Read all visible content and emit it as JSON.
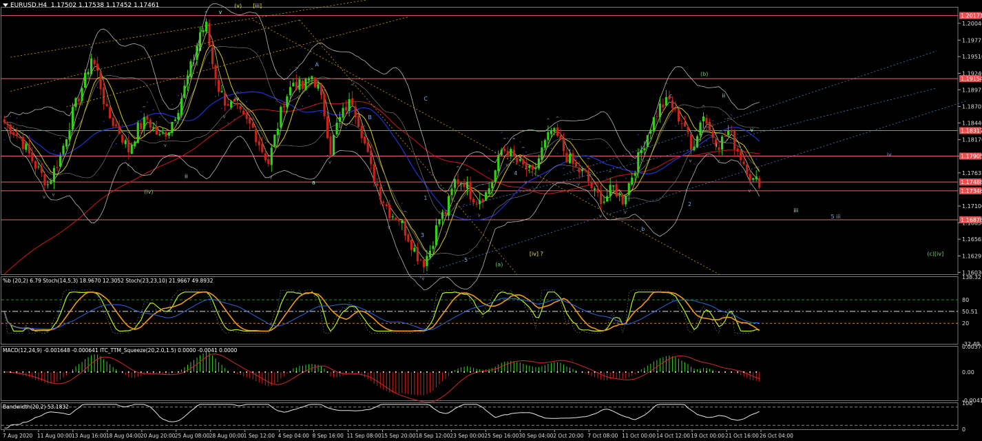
{
  "header": {
    "symbol": "EURUSD,H4",
    "ohlc": "1.17502 1.17538 1.17452 1.17461"
  },
  "colors": {
    "background": "#000000",
    "grid_line": "#2b2b2b",
    "hline": "#e06a6a",
    "candle_up": "#33d11a",
    "candle_down": "#d0201a",
    "ma_red": "#d01818",
    "ma_blue": "#2233cc",
    "ma_yellow": "#d8c81a",
    "bands": "#b8b8b8",
    "fib_orange": "#d8a010",
    "channel_blue": "#4f7fc7",
    "label_bg": "#e65050"
  },
  "chart_data": [
    {
      "type": "candlestick",
      "title": "EURUSD,H4",
      "ylim": [
        1.16,
        1.203
      ],
      "price_ticks": [
        "1.20046",
        "1.19775",
        "1.19510",
        "1.19240",
        "1.18975",
        "1.18705",
        "1.18440",
        "1.18170",
        "1.17905",
        "1.17635",
        "1.17100",
        "1.16830",
        "1.16565",
        "1.16295",
        "1.16030"
      ],
      "highlighted_levels": [
        "1.20171",
        "1.19154",
        "1.18317",
        "1.17905",
        "1.17488",
        "1.17346",
        "1.16878"
      ],
      "time_labels": [
        "7 Aug 2020",
        "11 Aug 00:00",
        "13 Aug 16:00",
        "18 Aug 04:00",
        "20 Aug 20:00",
        "25 Aug 08:00",
        "28 Aug 00:00",
        "1 Sep 12:00",
        "4 Sep 04:00",
        "8 Sep 16:00",
        "11 Sep 08:00",
        "15 Sep 20:00",
        "18 Sep 12:00",
        "23 Sep 00:00",
        "25 Sep 16:00",
        "30 Sep 04:00",
        "2 Oct 20:00",
        "7 Oct 08:00",
        "11 Oct 00:00",
        "14 Oct 12:00",
        "19 Oct 00:00",
        "21 Oct 16:00",
        "26 Oct 04:00"
      ],
      "close_path": [
        [
          0,
          1.1845
        ],
        [
          5,
          1.182
        ],
        [
          10,
          1.1775
        ],
        [
          14,
          1.1745
        ],
        [
          18,
          1.179
        ],
        [
          22,
          1.186
        ],
        [
          26,
          1.1915
        ],
        [
          28,
          1.195
        ],
        [
          30,
          1.1925
        ],
        [
          33,
          1.186
        ],
        [
          37,
          1.183
        ],
        [
          40,
          1.18
        ],
        [
          43,
          1.1835
        ],
        [
          46,
          1.185
        ],
        [
          50,
          1.182
        ],
        [
          53,
          1.1835
        ],
        [
          56,
          1.187
        ],
        [
          58,
          1.19
        ],
        [
          61,
          1.195
        ],
        [
          63,
          1.199
        ],
        [
          65,
          1.2
        ],
        [
          67,
          1.194
        ],
        [
          69,
          1.19
        ],
        [
          71,
          1.188
        ],
        [
          74,
          1.187
        ],
        [
          77,
          1.185
        ],
        [
          80,
          1.1835
        ],
        [
          83,
          1.18
        ],
        [
          85,
          1.178
        ],
        [
          87,
          1.182
        ],
        [
          90,
          1.188
        ],
        [
          93,
          1.191
        ],
        [
          96,
          1.19
        ],
        [
          99,
          1.192
        ],
        [
          101,
          1.19
        ],
        [
          103,
          1.186
        ],
        [
          105,
          1.18
        ],
        [
          107,
          1.184
        ],
        [
          110,
          1.187
        ],
        [
          112,
          1.188
        ],
        [
          115,
          1.183
        ],
        [
          118,
          1.177
        ],
        [
          121,
          1.173
        ],
        [
          124,
          1.17
        ],
        [
          127,
          1.169
        ],
        [
          130,
          1.166
        ],
        [
          133,
          1.163
        ],
        [
          135,
          1.162
        ],
        [
          137,
          1.164
        ],
        [
          140,
          1.169
        ],
        [
          142,
          1.17
        ],
        [
          145,
          1.175
        ],
        [
          148,
          1.175
        ],
        [
          150,
          1.173
        ],
        [
          152,
          1.172
        ],
        [
          155,
          1.173
        ],
        [
          157,
          1.175
        ],
        [
          160,
          1.18
        ],
        [
          162,
          1.18
        ],
        [
          165,
          1.178
        ],
        [
          168,
          1.177
        ],
        [
          170,
          1.176
        ],
        [
          173,
          1.18
        ],
        [
          176,
          1.183
        ],
        [
          178,
          1.182
        ],
        [
          181,
          1.179
        ],
        [
          184,
          1.177
        ],
        [
          187,
          1.176
        ],
        [
          190,
          1.173
        ],
        [
          193,
          1.172
        ],
        [
          196,
          1.174
        ],
        [
          199,
          1.172
        ],
        [
          202,
          1.176
        ],
        [
          205,
          1.18
        ],
        [
          208,
          1.184
        ],
        [
          211,
          1.187
        ],
        [
          214,
          1.188
        ],
        [
          216,
          1.186
        ],
        [
          219,
          1.184
        ],
        [
          221,
          1.18
        ],
        [
          223,
          1.183
        ],
        [
          225,
          1.186
        ],
        [
          227,
          1.183
        ],
        [
          230,
          1.181
        ],
        [
          233,
          1.183
        ],
        [
          236,
          1.18
        ],
        [
          239,
          1.177
        ],
        [
          241,
          1.175
        ]
      ],
      "overlays": [
        "Bollinger Bands (20,2)",
        "Moving averages (red, blue, yellow)",
        "Fibonacci channel (orange, dotted)",
        "Trend channel (blue, dotted)"
      ],
      "wave_labels": [
        "(iv)",
        "ii",
        "iii",
        "iv",
        "v",
        "(v)",
        "[iii]",
        "a",
        "A",
        "B",
        "C",
        "1",
        "2",
        "3",
        "4",
        "5",
        "[iv] ?",
        "(a)",
        "b",
        "c",
        "(b)",
        "i",
        "ii",
        "iii",
        "iv",
        "v",
        "(c)[iv]",
        "5 iii"
      ],
      "grid": false
    },
    {
      "type": "line",
      "title": "%b (20,2) 6.79  Stoch(14,5,3) 18.9670 12.3052  Stoch(23,23,10) 21.9667 49.8932",
      "ylim": [
        -32.49,
        138.32
      ],
      "ticks": [
        "138.32",
        "80",
        "50.51",
        "20",
        "-32.49"
      ],
      "labelled_values": [
        "80",
        "50.51",
        "20"
      ]
    },
    {
      "type": "bar",
      "title": "MACD(12,24,9) -0.001648 -0.000641  ITC_TTM_Squeeze(20,2.0,1.5) 0.0000 -0.0041 0.0000",
      "ylim": [
        -0.004141,
        0.003709
      ],
      "ticks": [
        "0.003709",
        "0.00",
        "-0.004141"
      ]
    },
    {
      "type": "line",
      "title": "Bandwidth(20,2) 53.1832",
      "ylim": [
        0,
        100
      ],
      "ticks": [
        "100",
        "0"
      ]
    }
  ]
}
